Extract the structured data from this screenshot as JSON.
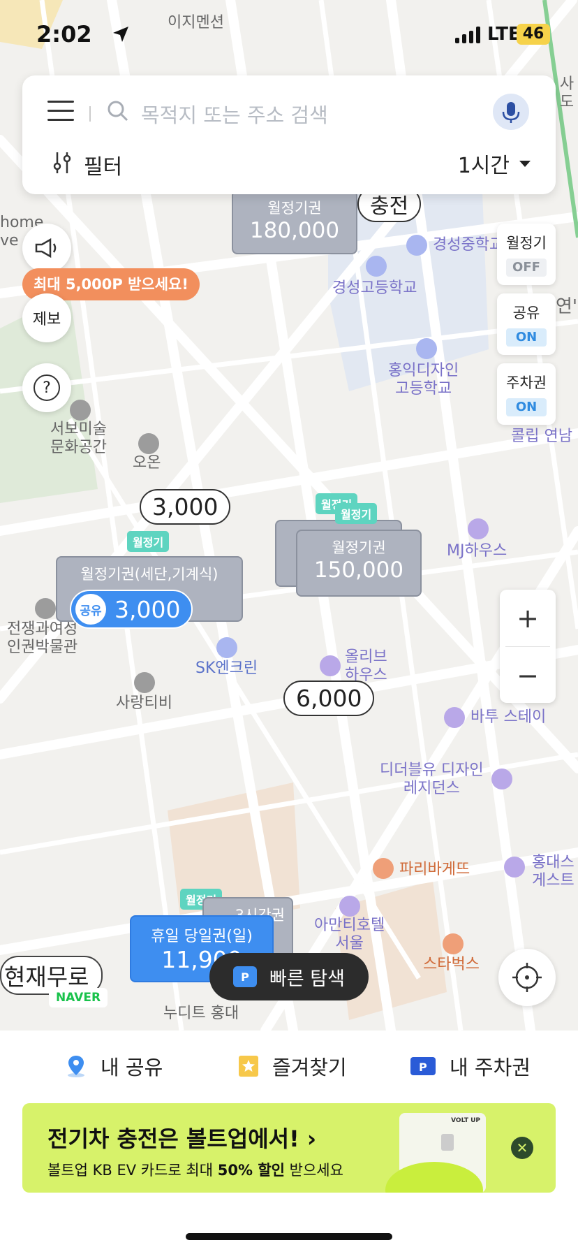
{
  "status_bar": {
    "time": "2:02",
    "network": "LTE",
    "battery": "46"
  },
  "search": {
    "placeholder": "목적지 또는 주소 검색",
    "filter_label": "필터",
    "time_option": "1시간"
  },
  "side_buttons": {
    "promo": "최대 5,000P 받으세요!",
    "report": "제보",
    "help": "?"
  },
  "toggles": [
    {
      "label": "월정기",
      "state": "OFF"
    },
    {
      "label": "공유",
      "state": "ON"
    },
    {
      "label": "주차권",
      "state": "ON"
    }
  ],
  "zoom": {
    "in": "+",
    "out": "−"
  },
  "map_labels": {
    "ijimensyeon": "이지멘션",
    "gyeongseong_mid": "경성중학교",
    "gyeongseong_high": "경성고등학교",
    "hongik_design": "홍익디자인\n고등학교",
    "seobo": "서보미술\n문화공간",
    "oon": "오온",
    "colibri": "콜립 연남",
    "mj_house": "MJ하우스",
    "museum": "전쟁과여성\n인권박물관",
    "sk": "SK엔크린",
    "olive": "올리브\n하우스",
    "sarang": "사랑티비",
    "batu": "바투 스테이",
    "ddu": "디더블유 디자인\n레지던스",
    "paris": "파리바게뜨",
    "hongdae_guest": "홍대스\n게스트",
    "amanti": "아만티호텔\n서울",
    "starbucks": "스타벅스",
    "nudit": "누디트 홍대",
    "home_text": "home\nve",
    "yeon": "연'",
    "sado": "사도",
    "road": "현재무로",
    "naver": "NAVER",
    "chungjeon": "충전"
  },
  "markers": {
    "monthly_1": {
      "title": "월정기권",
      "price": "180,000"
    },
    "monthly_2": {
      "title": "월정기권",
      "price": "150,000"
    },
    "monthly_3": {
      "title": "월정기권(세단,기계식)",
      "price": "3,000"
    },
    "badge": "월정기",
    "badge_partial": "월정기",
    "price_3000": "3,000",
    "price_6000": "6,000",
    "shared_badge": "공유",
    "shared_price": "3,000",
    "holiday": {
      "title": "휴일 당일권(일)",
      "price": "11,900"
    },
    "behind_title": "3시간권"
  },
  "quick_search": "빠른 탐색",
  "p_letter": "P",
  "bottom_tabs": [
    {
      "label": "내 공유",
      "icon": "location-pin-icon"
    },
    {
      "label": "즐겨찾기",
      "icon": "star-icon"
    },
    {
      "label": "내 주차권",
      "icon": "parking-ticket-icon"
    }
  ],
  "banner": {
    "title": "전기차 충전은 볼트업에서!",
    "sub_pre": "볼트업 KB EV 카드로 최대 ",
    "sub_bold": "50% 할인",
    "sub_post": " 받으세요",
    "card_brand": "VOLT UP"
  },
  "colors": {
    "accent_blue": "#3e8ef0",
    "promo_orange": "#f28f5d",
    "banner_lime": "#d7f26a",
    "badge_mint": "#5ed4c0"
  }
}
